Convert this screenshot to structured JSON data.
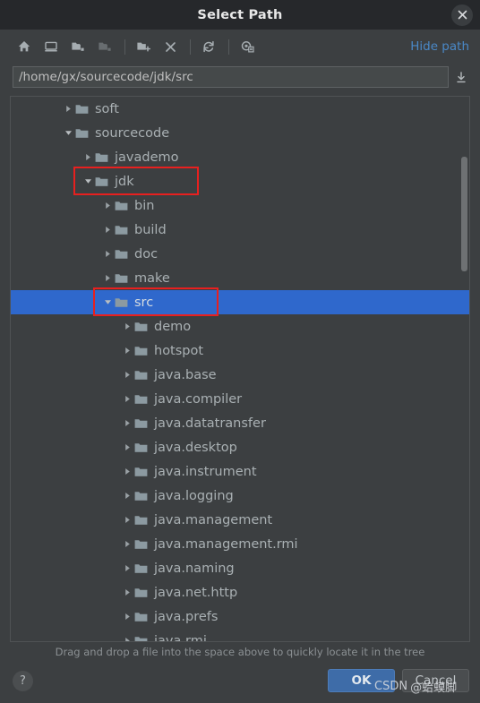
{
  "titlebar": {
    "title": "Select Path",
    "close_icon": "close-icon"
  },
  "toolbar": {
    "icons": [
      {
        "name": "home-icon",
        "tooltip": "Home",
        "disabled": false
      },
      {
        "name": "desktop-icon",
        "tooltip": "Desktop",
        "disabled": false
      },
      {
        "name": "project-folder-icon",
        "tooltip": "Project",
        "disabled": false
      },
      {
        "name": "module-folder-icon",
        "tooltip": "Module",
        "disabled": true
      },
      {
        "name": "new-folder-icon",
        "tooltip": "New Folder",
        "disabled": false
      },
      {
        "name": "delete-icon",
        "tooltip": "Delete",
        "disabled": false
      },
      {
        "name": "refresh-icon",
        "tooltip": "Refresh",
        "disabled": false
      },
      {
        "name": "show-hidden-files-icon",
        "tooltip": "Show Hidden Files and Directories",
        "disabled": false
      }
    ],
    "hide_path_label": "Hide path"
  },
  "path_field": {
    "value": "/home/gx/sourcecode/jdk/src",
    "placeholder": "",
    "expand_icon": "expand-path-icon"
  },
  "tree": {
    "rows": [
      {
        "label": "soft",
        "depth": 2,
        "state": "collapsed",
        "selected": false
      },
      {
        "label": "sourcecode",
        "depth": 2,
        "state": "expanded",
        "selected": false
      },
      {
        "label": "javademo",
        "depth": 3,
        "state": "collapsed",
        "selected": false
      },
      {
        "label": "jdk",
        "depth": 3,
        "state": "expanded",
        "selected": false,
        "annotated": true
      },
      {
        "label": "bin",
        "depth": 4,
        "state": "collapsed",
        "selected": false
      },
      {
        "label": "build",
        "depth": 4,
        "state": "collapsed",
        "selected": false
      },
      {
        "label": "doc",
        "depth": 4,
        "state": "collapsed",
        "selected": false
      },
      {
        "label": "make",
        "depth": 4,
        "state": "collapsed",
        "selected": false
      },
      {
        "label": "src",
        "depth": 4,
        "state": "expanded",
        "selected": true,
        "annotated": true
      },
      {
        "label": "demo",
        "depth": 5,
        "state": "collapsed",
        "selected": false
      },
      {
        "label": "hotspot",
        "depth": 5,
        "state": "collapsed",
        "selected": false
      },
      {
        "label": "java.base",
        "depth": 5,
        "state": "collapsed",
        "selected": false
      },
      {
        "label": "java.compiler",
        "depth": 5,
        "state": "collapsed",
        "selected": false
      },
      {
        "label": "java.datatransfer",
        "depth": 5,
        "state": "collapsed",
        "selected": false
      },
      {
        "label": "java.desktop",
        "depth": 5,
        "state": "collapsed",
        "selected": false
      },
      {
        "label": "java.instrument",
        "depth": 5,
        "state": "collapsed",
        "selected": false
      },
      {
        "label": "java.logging",
        "depth": 5,
        "state": "collapsed",
        "selected": false
      },
      {
        "label": "java.management",
        "depth": 5,
        "state": "collapsed",
        "selected": false
      },
      {
        "label": "java.management.rmi",
        "depth": 5,
        "state": "collapsed",
        "selected": false
      },
      {
        "label": "java.naming",
        "depth": 5,
        "state": "collapsed",
        "selected": false
      },
      {
        "label": "java.net.http",
        "depth": 5,
        "state": "collapsed",
        "selected": false
      },
      {
        "label": "java.prefs",
        "depth": 5,
        "state": "collapsed",
        "selected": false
      },
      {
        "label": "java.rmi",
        "depth": 5,
        "state": "collapsed",
        "selected": false
      }
    ],
    "scrollbar": {
      "thumb_top_pct": 11,
      "thumb_height_pct": 21
    }
  },
  "hint": {
    "text": "Drag and drop a file into the space above to quickly locate it in the tree"
  },
  "footer": {
    "help_label": "?",
    "ok_label": "OK",
    "cancel_label": "Cancel"
  },
  "watermark": {
    "site": "CSDN",
    "handle": "@蛤蟆脚"
  },
  "colors": {
    "dialog_bg": "#3c3f41",
    "titlebar_bg": "#26282b",
    "selection_blue": "#2f68cc",
    "link_blue": "#4a88c7",
    "ok_button_blue": "#3e6ca8",
    "annotation_red": "#e8201f",
    "folder_icon": "#8c9aa1",
    "text": "#a9b0b3"
  }
}
